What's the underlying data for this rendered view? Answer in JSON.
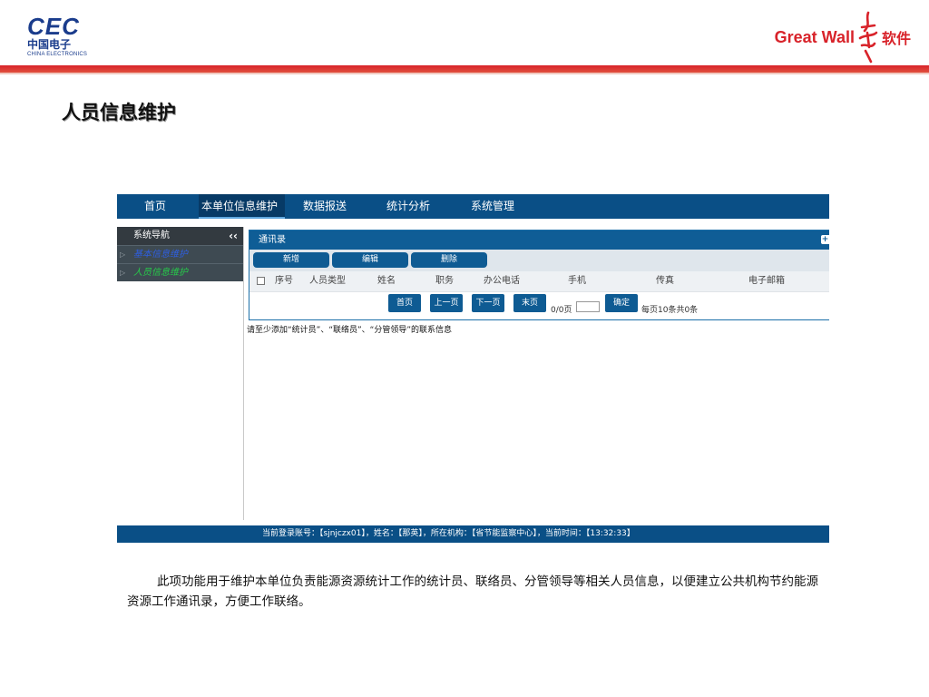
{
  "slide": {
    "title": "人员信息维护",
    "description": "此项功能用于维护本单位负责能源资源统计工作的统计员、联络员、分管领导等相关人员信息，以便建立公共机构节约能源资源工作通讯录，方便工作联络。"
  },
  "logos": {
    "cec": {
      "big": "CEC",
      "cn": "中国电子",
      "en": "CHINA ELECTRONICS"
    },
    "greatwall": {
      "en": "Great Wall",
      "cn": "软件"
    }
  },
  "colors": {
    "header_red": "#d8232a",
    "nav_blue": "#0a4f86",
    "button_blue": "#0e5b93"
  },
  "app": {
    "nav": [
      "首页",
      "本单位信息维护",
      "数据报送",
      "统计分析",
      "系统管理"
    ],
    "nav_active": "本单位信息维护",
    "sidebar": {
      "title": "系统导航",
      "collapse": "‹‹",
      "items": [
        "基本信息维护",
        "人员信息维护"
      ]
    },
    "panel": {
      "title": "通讯录",
      "buttons": {
        "add": "新增",
        "edit": "编辑",
        "delete": "删除"
      },
      "columns": [
        "序号",
        "人员类型",
        "姓名",
        "职务",
        "办公电话",
        "手机",
        "传真",
        "电子邮箱"
      ]
    },
    "pager": {
      "first": "首页",
      "prev": "上一页",
      "next": "下一页",
      "last": "末页",
      "page_info": "0/0页",
      "confirm": "确定",
      "summary": "每页10条共0条"
    },
    "note": "请至少添加“统计员”、“联络员”、“分管领导”的联系信息",
    "status": "当前登录账号：【sjnjczx01】，姓名：【那英】，所在机构：【省节能监察中心】，当前时间：【13:32:33】"
  }
}
